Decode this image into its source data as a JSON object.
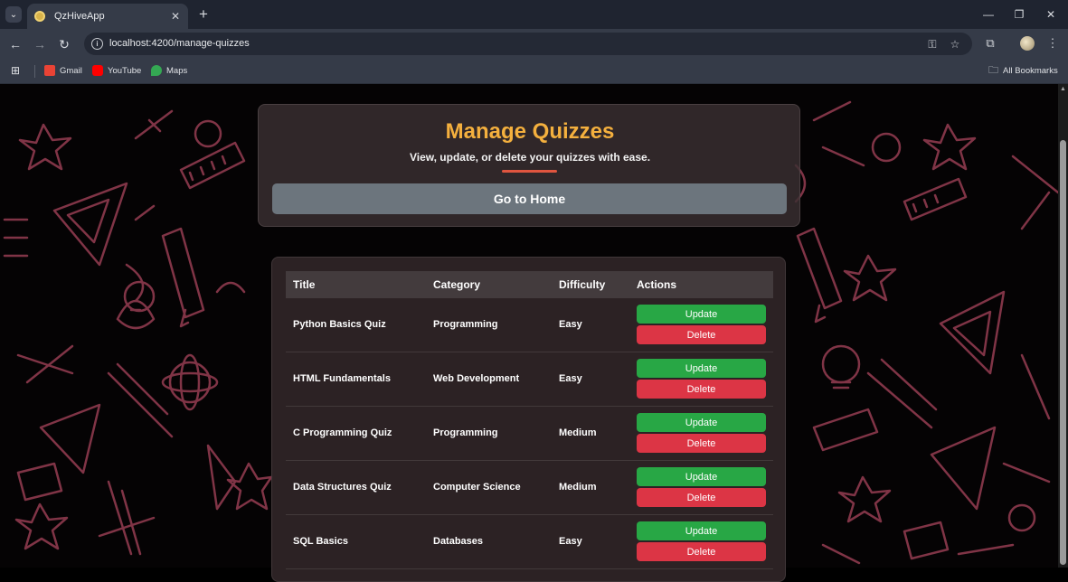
{
  "browser": {
    "tab_title": "QzHiveApp",
    "url": "localhost:4200/manage-quizzes",
    "bookmarks": [
      {
        "label": "Gmail",
        "color": "#ea4335"
      },
      {
        "label": "YouTube",
        "color": "#ff0000"
      },
      {
        "label": "Maps",
        "color": "#34a853"
      }
    ],
    "all_bookmarks_label": "All Bookmarks"
  },
  "header": {
    "title": "Manage Quizzes",
    "subtitle": "View, update, or delete your quizzes with ease.",
    "home_button_label": "Go to Home"
  },
  "table": {
    "columns": [
      "Title",
      "Category",
      "Difficulty",
      "Actions"
    ],
    "rows": [
      {
        "title": "Python Basics Quiz",
        "category": "Programming",
        "difficulty": "Easy"
      },
      {
        "title": "HTML Fundamentals",
        "category": "Web Development",
        "difficulty": "Easy"
      },
      {
        "title": "C Programming Quiz",
        "category": "Programming",
        "difficulty": "Medium"
      },
      {
        "title": "Data Structures Quiz",
        "category": "Computer Science",
        "difficulty": "Medium"
      },
      {
        "title": "SQL Basics",
        "category": "Databases",
        "difficulty": "Easy"
      }
    ],
    "update_label": "Update",
    "delete_label": "Delete"
  },
  "colors": {
    "accent_title": "#f4b03e",
    "update_button": "#28a745",
    "delete_button": "#dc3545",
    "home_button": "#6c757d",
    "doodle": "#8e3a4e"
  }
}
